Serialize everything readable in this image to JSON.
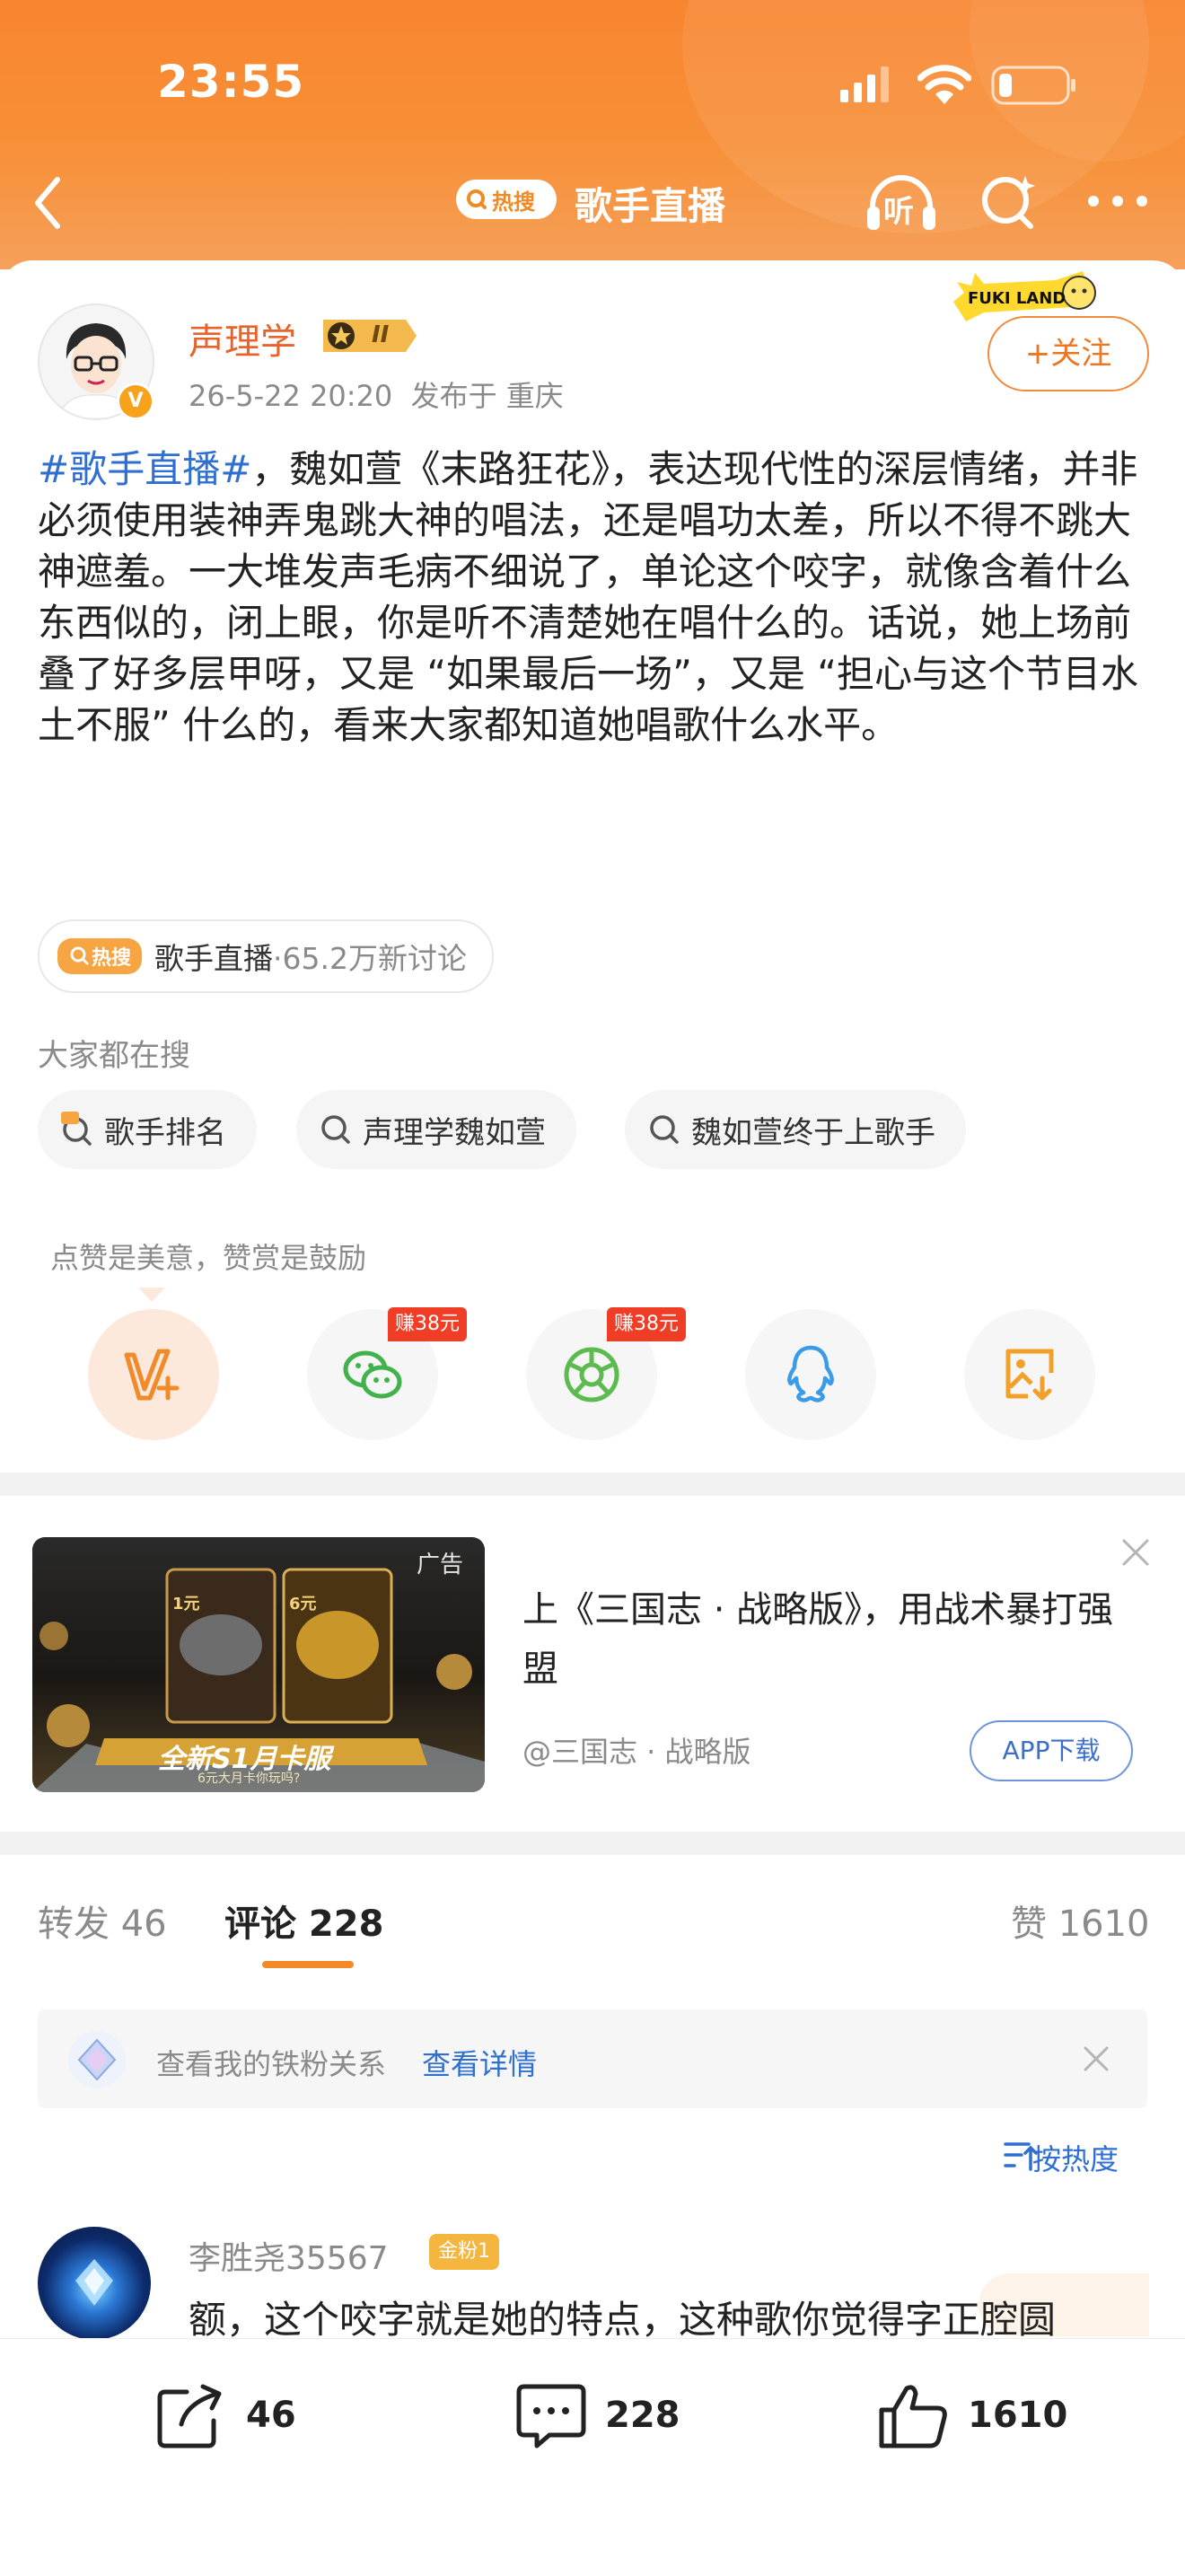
{
  "status_bar": {
    "time": "23:55"
  },
  "nav": {
    "hot_label": "热搜",
    "title": "歌手直播",
    "listen_label": "听"
  },
  "post": {
    "username": "声理学",
    "rank_badge": "II",
    "verified": "V",
    "date": "26-5-22 20:20",
    "location": "发布于 重庆",
    "follow_label": "+关注",
    "decor_text": "FUKI LAND",
    "hashtag": "#歌手直播#",
    "body": "，魏如萱《末路狂花》，表达现代性的深层情绪，并非必须使用装神弄鬼跳大神的唱法，还是唱功太差，所以不得不跳大神遮羞。一大堆发声毛病不细说了，单论这个咬字，就像含着什么东西似的，闭上眼，你是听不清楚她在唱什么的。话说，她上场前叠了好多层甲呀，又是 “如果最后一场”，又是 “担心与这个节目水土不服” 什么的，看来大家都知道她唱歌什么水平。"
  },
  "topic": {
    "hot_label": "热搜",
    "name": "歌手直播",
    "stats": "·65.2万新讨论"
  },
  "search": {
    "label": "大家都在搜",
    "chips": [
      "歌手排名",
      "声理学魏如萱",
      "魏如萱终于上歌手"
    ]
  },
  "reward": {
    "label": "点赞是美意，赞赏是鼓励",
    "earn_badge": "赚38元"
  },
  "ad": {
    "tag": "广告",
    "title": "上《三国志 · 战略版》，用战术暴打强盟",
    "source": "@三国志 · 战略版",
    "button": "APP下载",
    "banner_text": "全新S1月卡服",
    "banner_sub": "6元大月卡你玩吗?",
    "price1": "1元",
    "price2": "6元"
  },
  "tabs": {
    "repost": "转发 46",
    "comments": "评论 228",
    "likes": "赞 1610"
  },
  "fans": {
    "text": "查看我的铁粉关系",
    "link": "查看详情"
  },
  "sort": {
    "label": "按热度"
  },
  "comment": {
    "name": "李胜尧35567",
    "badge": "金粉1",
    "text": "额，这个咬字就是她的特点，这种歌你觉得字正腔圆"
  },
  "bottom": {
    "repost_count": "46",
    "comment_count": "228",
    "like_count": "1610"
  },
  "colors": {
    "header": "#f8852f",
    "accent": "#f07520",
    "link": "#2f6fd1"
  }
}
